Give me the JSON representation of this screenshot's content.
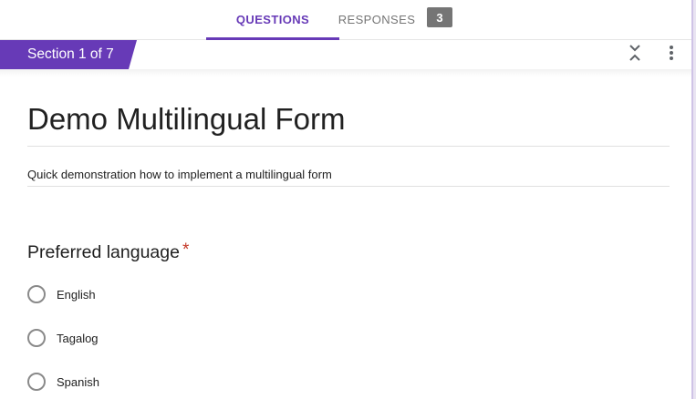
{
  "tabs": {
    "questions_label": "QUESTIONS",
    "responses_label": "RESPONSES",
    "responses_count": "3"
  },
  "section": {
    "label": "Section 1 of 7"
  },
  "form": {
    "title": "Demo Multilingual Form",
    "description": "Quick demonstration how to implement a multilingual form"
  },
  "question": {
    "title": "Preferred language",
    "required_marker": "*",
    "options": [
      {
        "label": "English"
      },
      {
        "label": "Tagalog"
      },
      {
        "label": "Spanish"
      }
    ]
  },
  "icons": {
    "collapse": "collapse-section-icon",
    "more": "more-vert-icon"
  },
  "colors": {
    "accent": "#673ab7",
    "required": "#c53929",
    "badge": "#757575"
  }
}
